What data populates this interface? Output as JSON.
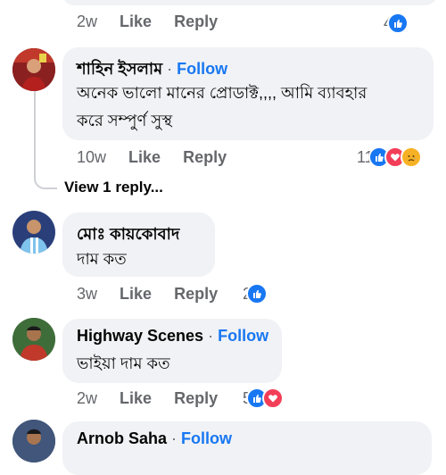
{
  "top_comment": {
    "time": "2w",
    "like": "Like",
    "reply": "Reply",
    "count": "4"
  },
  "comment1": {
    "name": "শাহিন ইসলাম",
    "follow": "Follow",
    "separator": "·",
    "text_line1": "অনেক ভালো মানের প্রোডাক্ট,,,, আমি ব্যাবহার",
    "text_line2": "করে সম্পুর্ণ সুস্থ",
    "time": "10w",
    "like": "Like",
    "reply": "Reply",
    "count": "11",
    "view_replies": "View 1 reply..."
  },
  "comment2": {
    "name": "মোঃ কায়কোবাদ",
    "text": "দাম কত",
    "time": "3w",
    "like": "Like",
    "reply": "Reply",
    "count": "2"
  },
  "comment3": {
    "name": "Highway Scenes",
    "follow": "Follow",
    "separator": "·",
    "text": "ভাইয়া দাম কত",
    "time": "2w",
    "like": "Like",
    "reply": "Reply",
    "count": "5"
  },
  "comment4": {
    "name": "Arnob Saha",
    "follow": "Follow",
    "separator": "·"
  },
  "colors": {
    "link": "#1877f2",
    "like": "#1877f2",
    "love": "#f33e58",
    "sad": "#f7b125",
    "meta": "#65676b"
  },
  "icons": [
    "like-reaction-icon",
    "love-reaction-icon",
    "sad-reaction-icon"
  ]
}
